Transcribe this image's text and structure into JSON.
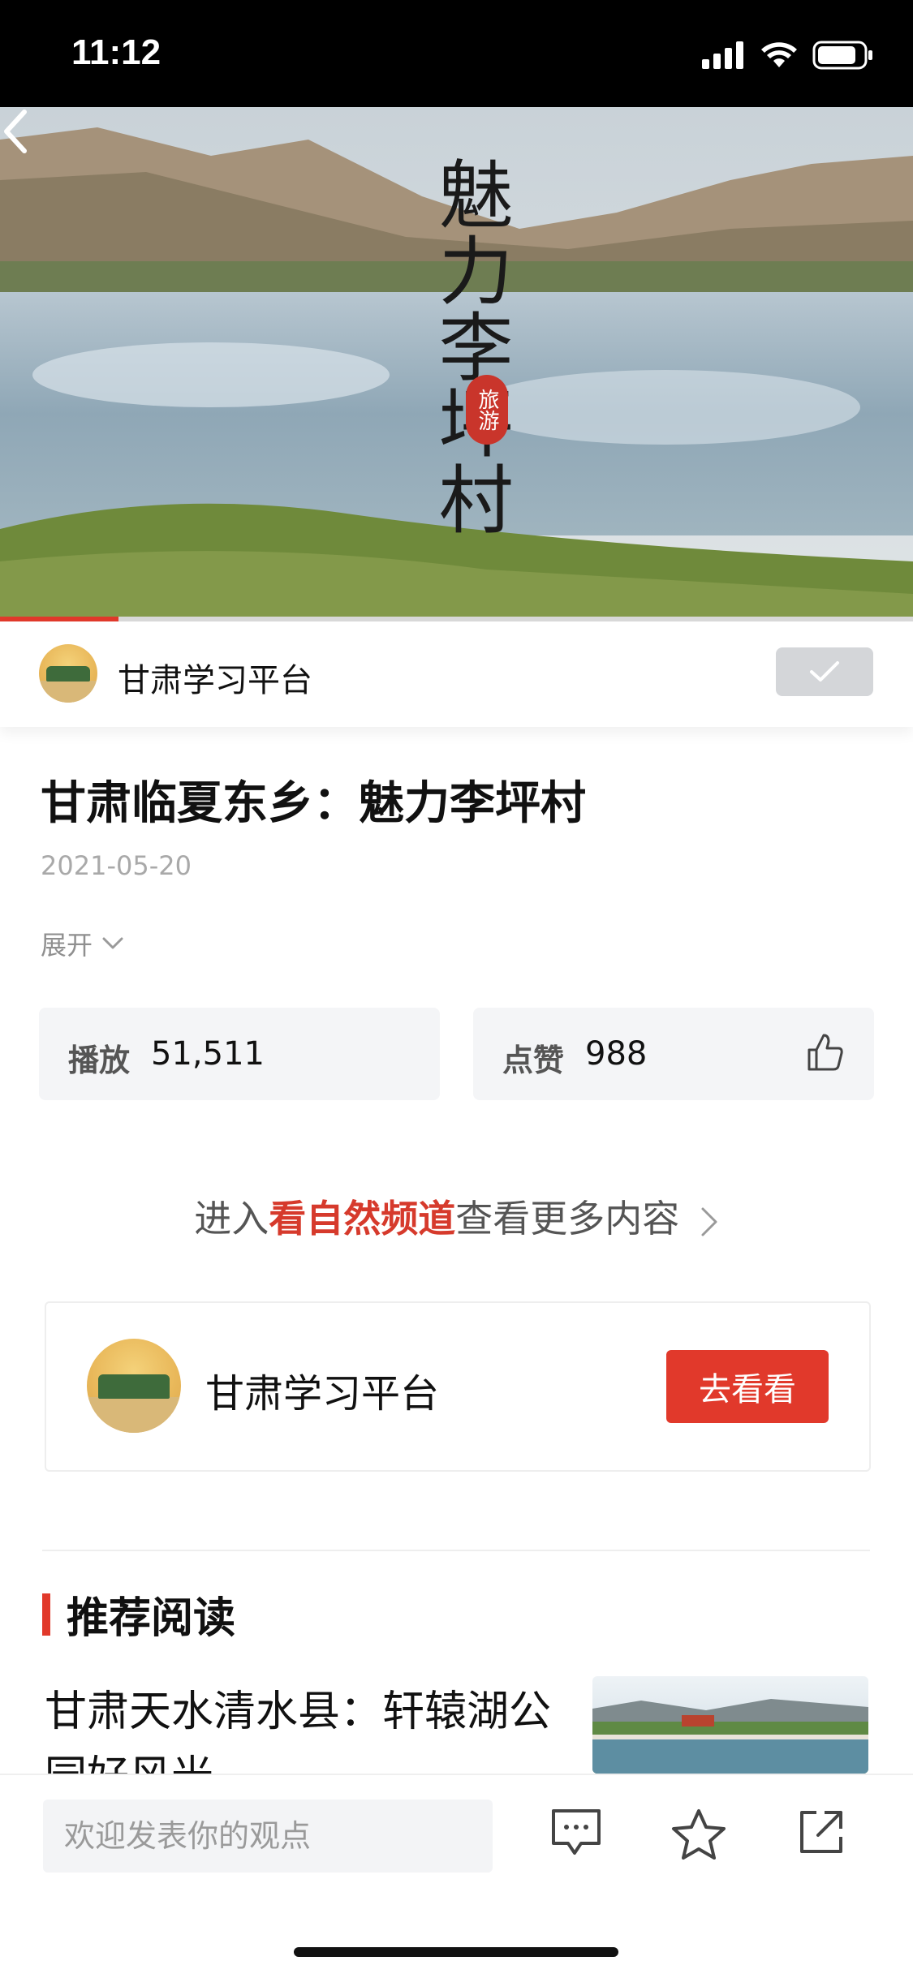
{
  "status_bar": {
    "time": "11:12"
  },
  "hero": {
    "title": "魅力李坪村",
    "seal_text": "旅游",
    "video_progress_fraction": 0.13
  },
  "publisher": {
    "name": "甘肃学习平台"
  },
  "article": {
    "title": "甘肃临夏东乡：魅力李坪村",
    "date": "2021-05-20",
    "expand_label": "展开"
  },
  "stats": {
    "play_label": "播放",
    "play_count": "51,511",
    "like_label": "点赞",
    "like_count": "988"
  },
  "channel_link": {
    "prefix": "进入",
    "channel": "看自然频道",
    "suffix": "查看更多内容"
  },
  "publisher_card": {
    "name": "甘肃学习平台",
    "button_label": "去看看"
  },
  "recommend": {
    "section_title": "推荐阅读",
    "items": [
      {
        "title": "甘肃天水清水县：轩辕湖公园好风光"
      }
    ]
  },
  "bottom_bar": {
    "comment_placeholder": "欢迎发表你的观点",
    "icons": [
      "comment-icon",
      "star-icon",
      "share-icon"
    ]
  },
  "colors": {
    "accent": "#e1392b",
    "status_bar_bg": "#000000",
    "follow_button_bg": "#d4d6d9"
  }
}
